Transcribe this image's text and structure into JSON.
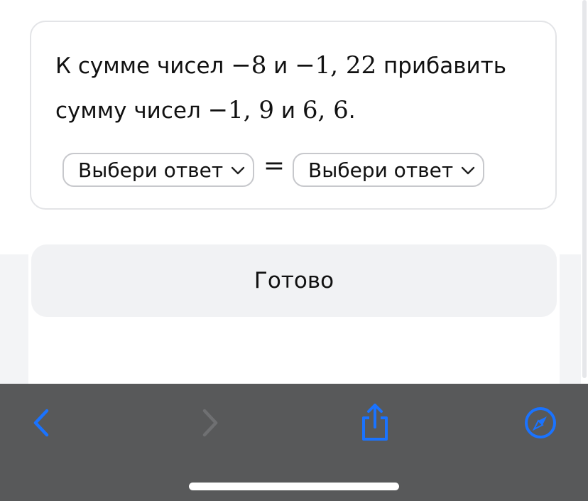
{
  "question": {
    "t1": "К сумме чисел ",
    "m1": "−8",
    "t2": " и ",
    "m2": "−1, 22",
    "t3": " прибавить сумму чисел ",
    "m3": "−1, 9",
    "t4": " и ",
    "m4": "6, 6",
    "t5": "."
  },
  "answer": {
    "left_select": "Выбери ответ",
    "equals": "=",
    "right_select": "Выбери ответ"
  },
  "done_button": "Готово",
  "toolbar": {
    "icons": [
      "back-icon",
      "forward-icon",
      "share-icon",
      "compass-icon"
    ],
    "active_color": "#1a73ff",
    "disabled_color": "#6f7072"
  },
  "colors": {
    "card_border": "#e3e4e7",
    "button_bg": "#f1f2f4",
    "toolbar_bg": "#58595a"
  }
}
